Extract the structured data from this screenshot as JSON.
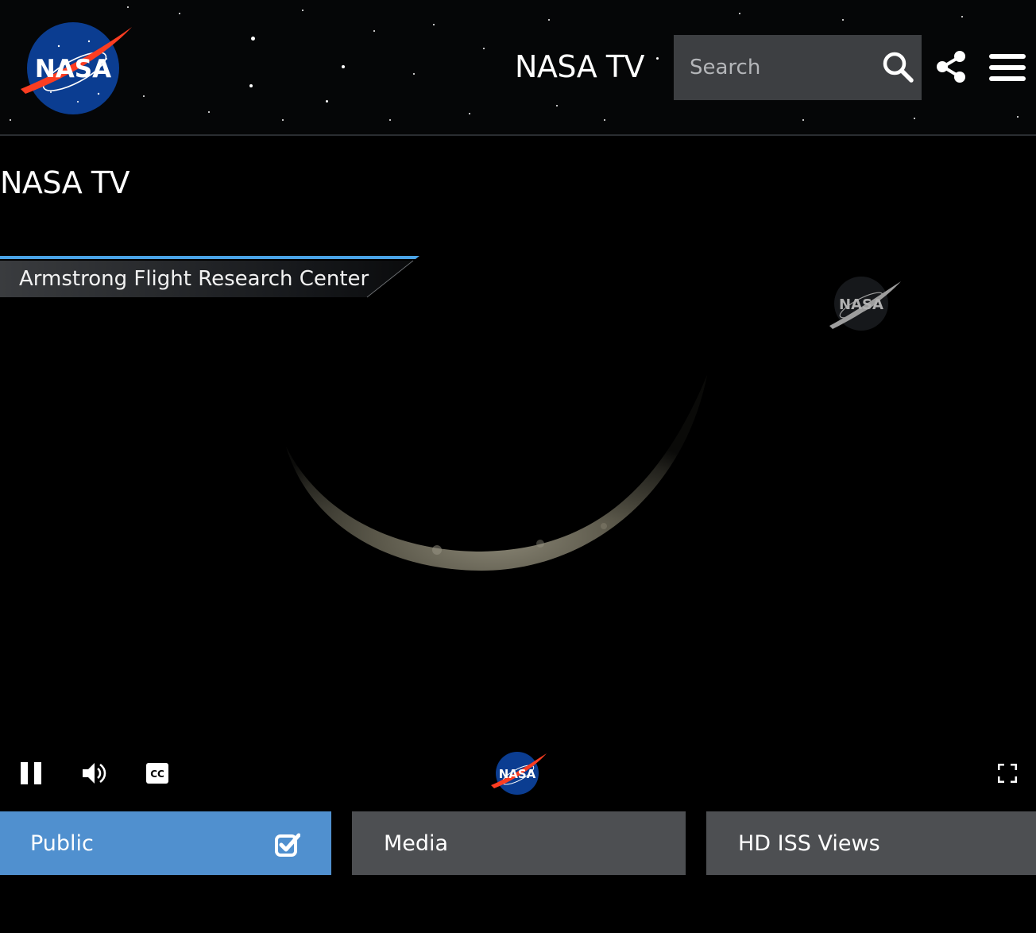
{
  "header": {
    "logo_text": "NASA",
    "title": "NASA TV",
    "search_placeholder": "Search",
    "icons": [
      "nasa-logo",
      "search-icon",
      "share-icon",
      "menu-icon"
    ]
  },
  "page": {
    "title": "NASA TV"
  },
  "player": {
    "lower_third": "Armstrong Flight Research Center",
    "watermark_text": "NASA",
    "controls": {
      "pause_icon": "pause-icon",
      "volume_icon": "volume-icon",
      "cc_label": "CC",
      "center_logo_text": "NASA",
      "fullscreen_icon": "fullscreen-icon"
    }
  },
  "channels": [
    {
      "label": "Public",
      "selected": true
    },
    {
      "label": "Media",
      "selected": false
    },
    {
      "label": "HD ISS Views",
      "selected": false
    }
  ],
  "colors": {
    "selected_tab": "#5090cf",
    "tab": "#4d4f52",
    "search_bg": "#3d3f42",
    "lower_third_accent": "#4aa3e6"
  }
}
